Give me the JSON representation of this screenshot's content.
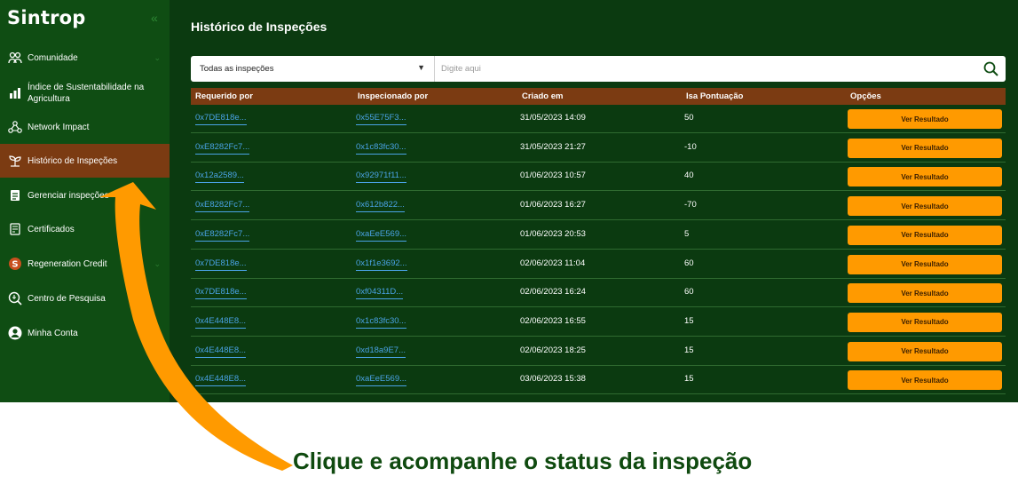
{
  "brand": {
    "name": "Sintrop"
  },
  "sidebar": {
    "items": [
      {
        "label": "Comunidade",
        "icon": "community-icon"
      },
      {
        "label": "Índice de Sustentabilidade na Agricultura",
        "icon": "sustainability-index-icon"
      },
      {
        "label": "Network Impact",
        "icon": "network-icon"
      },
      {
        "label": "Histórico de Inspeções",
        "icon": "inspection-history-icon"
      },
      {
        "label": "Gerenciar inspeções",
        "icon": "manage-inspections-icon"
      },
      {
        "label": "Certificados",
        "icon": "certificate-icon"
      },
      {
        "label": "Regeneration Credit",
        "icon": "regeneration-credit-icon"
      },
      {
        "label": "Centro de Pesquisa",
        "icon": "research-center-icon"
      },
      {
        "label": "Minha Conta",
        "icon": "account-icon"
      }
    ]
  },
  "main": {
    "title": "Histórico de Inspeções",
    "filter": {
      "selected": "Todas as inspeções"
    },
    "search": {
      "placeholder": "Digite aqui"
    },
    "columns": [
      "Requerido por",
      "Inspecionado por",
      "Criado em",
      "Isa Pontuação",
      "Opções"
    ],
    "button_label": "Ver Resultado",
    "rows": [
      {
        "requested_by": "0x7DE818e...",
        "inspected_by": "0x55E75F3...",
        "created_at": "31/05/2023 14:09",
        "isa_score": "50"
      },
      {
        "requested_by": "0xE8282Fc7...",
        "inspected_by": "0x1c83fc30...",
        "created_at": "31/05/2023 21:27",
        "isa_score": "-10"
      },
      {
        "requested_by": "0x12a2589...",
        "inspected_by": "0x92971f11...",
        "created_at": "01/06/2023 10:57",
        "isa_score": "40"
      },
      {
        "requested_by": "0xE8282Fc7...",
        "inspected_by": "0x612b822...",
        "created_at": "01/06/2023 16:27",
        "isa_score": "-70"
      },
      {
        "requested_by": "0xE8282Fc7...",
        "inspected_by": "0xaEeE569...",
        "created_at": "01/06/2023 20:53",
        "isa_score": "5"
      },
      {
        "requested_by": "0x7DE818e...",
        "inspected_by": "0x1f1e3692...",
        "created_at": "02/06/2023 11:04",
        "isa_score": "60"
      },
      {
        "requested_by": "0x7DE818e...",
        "inspected_by": "0xf04311D...",
        "created_at": "02/06/2023 16:24",
        "isa_score": "60"
      },
      {
        "requested_by": "0x4E448E8...",
        "inspected_by": "0x1c83fc30...",
        "created_at": "02/06/2023 16:55",
        "isa_score": "15"
      },
      {
        "requested_by": "0x4E448E8...",
        "inspected_by": "0xd18a9E7...",
        "created_at": "02/06/2023 18:25",
        "isa_score": "15"
      },
      {
        "requested_by": "0x4E448E8...",
        "inspected_by": "0xaEeE569...",
        "created_at": "03/06/2023 15:38",
        "isa_score": "15"
      }
    ]
  },
  "caption": "Clique e acompanhe o status da inspeção",
  "colors": {
    "sidebar": "#0f4d13",
    "background": "#0b3a10",
    "accent": "#7b3b12",
    "button": "#ff9a00",
    "arrow": "#ff9a00",
    "link": "#4aa3e6"
  }
}
